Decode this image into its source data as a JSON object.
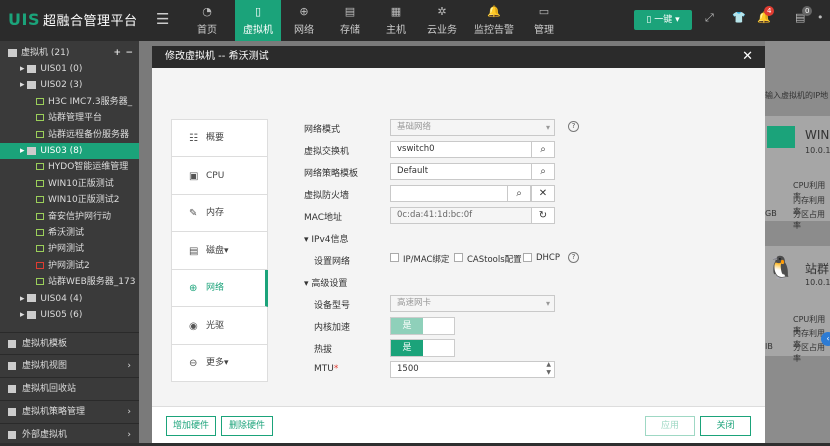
{
  "app": {
    "logo": "UIS",
    "title": "超融合管理平台"
  },
  "nav": [
    {
      "label": "首页",
      "icon": "gauge-icon"
    },
    {
      "label": "虚拟机",
      "icon": "vm-icon",
      "active": true
    },
    {
      "label": "网络",
      "icon": "globe-icon"
    },
    {
      "label": "存储",
      "icon": "database-icon"
    },
    {
      "label": "主机",
      "icon": "server-icon"
    },
    {
      "label": "云业务",
      "icon": "gear-icon"
    },
    {
      "label": "监控告警",
      "icon": "bell-icon"
    },
    {
      "label": "管理",
      "icon": "monitor-icon"
    }
  ],
  "topbar": {
    "onekey_label": "一键",
    "alert_count": "4",
    "msg_count": "0"
  },
  "sidebar": {
    "vm_root": "虚拟机 (21)",
    "tree": [
      {
        "label": "UIS01 (0)",
        "level": 1,
        "kind": "host"
      },
      {
        "label": "UIS02 (3)",
        "level": 1,
        "kind": "host"
      },
      {
        "label": "H3C IMC7.3服务器_",
        "level": 2,
        "kind": "vm"
      },
      {
        "label": "站群管理平台",
        "level": 2,
        "kind": "vm"
      },
      {
        "label": "站群远程备份服务器",
        "level": 2,
        "kind": "vm"
      },
      {
        "label": "UIS03 (8)",
        "level": 1,
        "kind": "host",
        "selected": true
      },
      {
        "label": "HYDO智能运维管理",
        "level": 2,
        "kind": "vm"
      },
      {
        "label": "WIN10正版测试",
        "level": 2,
        "kind": "vm"
      },
      {
        "label": "WIN10正版测试2",
        "level": 2,
        "kind": "vm"
      },
      {
        "label": "奋安信护网行动",
        "level": 2,
        "kind": "vm"
      },
      {
        "label": "希沃测试",
        "level": 2,
        "kind": "vm"
      },
      {
        "label": "护网测试",
        "level": 2,
        "kind": "vm"
      },
      {
        "label": "护网测试2",
        "level": 2,
        "kind": "vm-red"
      },
      {
        "label": "站群WEB服务器_173",
        "level": 2,
        "kind": "vm"
      },
      {
        "label": "UIS04 (4)",
        "level": 1,
        "kind": "host"
      },
      {
        "label": "UIS05 (6)",
        "level": 1,
        "kind": "host"
      }
    ],
    "sections": [
      {
        "label": "虚拟机模板",
        "chevron": ""
      },
      {
        "label": "虚拟机视图",
        "chevron": "›"
      },
      {
        "label": "虚拟机回收站",
        "chevron": ""
      },
      {
        "label": "虚拟机策略管理",
        "chevron": "›"
      },
      {
        "label": "外部虚拟机",
        "chevron": "›"
      }
    ]
  },
  "background": {
    "search_hint": "输入虚拟机的IP地",
    "card1": {
      "title": "WIN",
      "ip": "10.0.1",
      "rows": [
        "CPU利用率",
        "内存利用率",
        "分区占用率"
      ],
      "gb": "GB"
    },
    "card2": {
      "title": "站群",
      "ip": "10.0.1",
      "rows": [
        "CPU利用率",
        "内存利用率",
        "分区占用率"
      ],
      "gb": "IB"
    }
  },
  "dialog": {
    "title": "修改虚拟机 -- 希沃测试",
    "tabs": [
      {
        "label": "概要",
        "icon": "list-icon"
      },
      {
        "label": "CPU",
        "icon": "cpu-icon"
      },
      {
        "label": "内存",
        "icon": "memory-icon"
      },
      {
        "label": "磁盘▾",
        "icon": "disk-icon"
      },
      {
        "label": "网络",
        "icon": "network-globe-icon",
        "active": true
      },
      {
        "label": "光驱",
        "icon": "disc-icon"
      },
      {
        "label": "更多▾",
        "icon": "more-icon"
      }
    ],
    "form": {
      "network_mode_label": "网络模式",
      "network_mode_value": "基础网络",
      "vswitch_label": "虚拟交换机",
      "vswitch_value": "vswitch0",
      "policy_label": "网络策略模板",
      "policy_value": "Default",
      "firewall_label": "虚拟防火墙",
      "firewall_value": "",
      "mac_label": "MAC地址",
      "mac_value": "0c:da:41:1d:bc:0f",
      "ipv4_section": "IPv4信息",
      "set_network_label": "设置网络",
      "opt_ipmac": "IP/MAC绑定",
      "opt_castools": "CAStools配置",
      "opt_dhcp": "DHCP",
      "advanced_section": "高级设置",
      "device_model_label": "设备型号",
      "device_model_value": "高速网卡",
      "kernel_accel_label": "内核加速",
      "kernel_accel_value": "是",
      "hotplug_label": "热拔",
      "hotplug_value": "是",
      "mtu_label": "MTU",
      "mtu_required": "*",
      "mtu_value": "1500"
    },
    "footer": {
      "add_hw": "增加硬件",
      "del_hw": "删除硬件",
      "apply": "应用",
      "close": "关闭"
    }
  }
}
